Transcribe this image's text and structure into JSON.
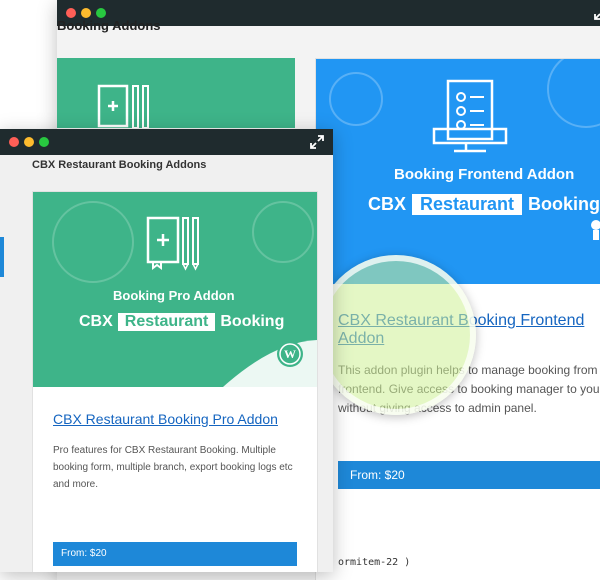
{
  "back_window": {
    "page_heading": "Booking Addons",
    "card": {
      "banner_title": "Booking Frontend Addon",
      "brand_left": "CBX",
      "brand_pill": "Restaurant",
      "brand_right": "Booking",
      "title_link": "CBX Restaurant Booking Frontend Addon",
      "description": "This addon plugin helps to manage booking from frontend. Give access to booking manager to your staffs without giving access to admin panel.",
      "price_button": "From: $20"
    },
    "code_fragment": "ormitem-22 )"
  },
  "front_window": {
    "page_heading": "CBX Restaurant Booking Addons",
    "card": {
      "banner_title": "Booking Pro Addon",
      "brand_left": "CBX",
      "brand_pill": "Restaurant",
      "brand_right": "Booking",
      "title_link": "CBX Restaurant Booking Pro Addon",
      "description": "Pro features for CBX Restaurant Booking. Multiple booking form, multiple branch, export booking logs etc and more.",
      "price_button": "From: $20"
    }
  },
  "colors": {
    "titlebar": "#1f2b2e",
    "green_banner": "#3eb489",
    "blue_banner": "#2196f3",
    "button": "#1e88d8",
    "link": "#1565c0"
  },
  "icons": [
    "expand-icon",
    "notebook-icon",
    "checklist-monitor-icon",
    "wordpress-icon"
  ]
}
